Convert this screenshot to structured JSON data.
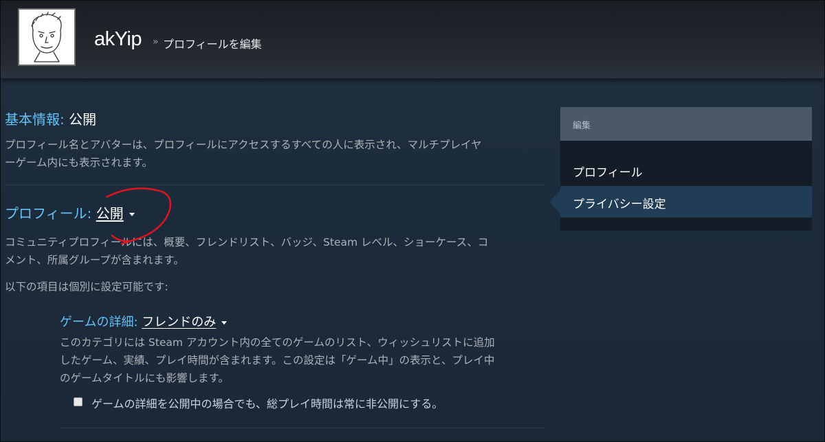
{
  "header": {
    "persona_name": "akYip",
    "breadcrumb_sep": "»",
    "breadcrumb": "プロフィールを編集"
  },
  "basic": {
    "label": "基本情報:",
    "value": "公開",
    "description_line1": "プロフィール名とアバターは、プロフィールにアクセスするすべての人に表示され、マルチプレイヤ",
    "description_line2": "ーゲーム内にも表示されます。"
  },
  "profile": {
    "label": "プロフィール:",
    "value": "公開",
    "description_line1": "コミュニティプロフィールには、概要、フレンドリスト、バッジ、Steam レベル、ショーケース、コ",
    "description_line2": "メント、所属グループが含まれます。",
    "individual_note": "以下の項目は個別に設定可能です:"
  },
  "game_details": {
    "label": "ゲームの詳細:",
    "value": "フレンドのみ",
    "description_line1": "このカテゴリには Steam アカウント内の全てのゲームのリスト、ウィッシュリストに追加",
    "description_line2": "したゲーム、実績、プレイ時間が含まれます。この設定は「ゲーム中」の表示と、プレイ中",
    "description_line3": "のゲームタイトルにも影響します。",
    "checkbox_label": "ゲームの詳細を公開中の場合でも、総プレイ時間は常に非公開にする。",
    "checkbox_checked": false
  },
  "sidebar": {
    "heading": "編集",
    "items": [
      {
        "label": "プロフィール",
        "active": false
      },
      {
        "label": "プライバシー設定",
        "active": true
      }
    ]
  },
  "colors": {
    "background": "#1b2838",
    "accent_label": "#66c0f4",
    "sidebar_active": "#213d56",
    "sidebar_heading": "#4b5868",
    "annotation": "#e0141e"
  }
}
